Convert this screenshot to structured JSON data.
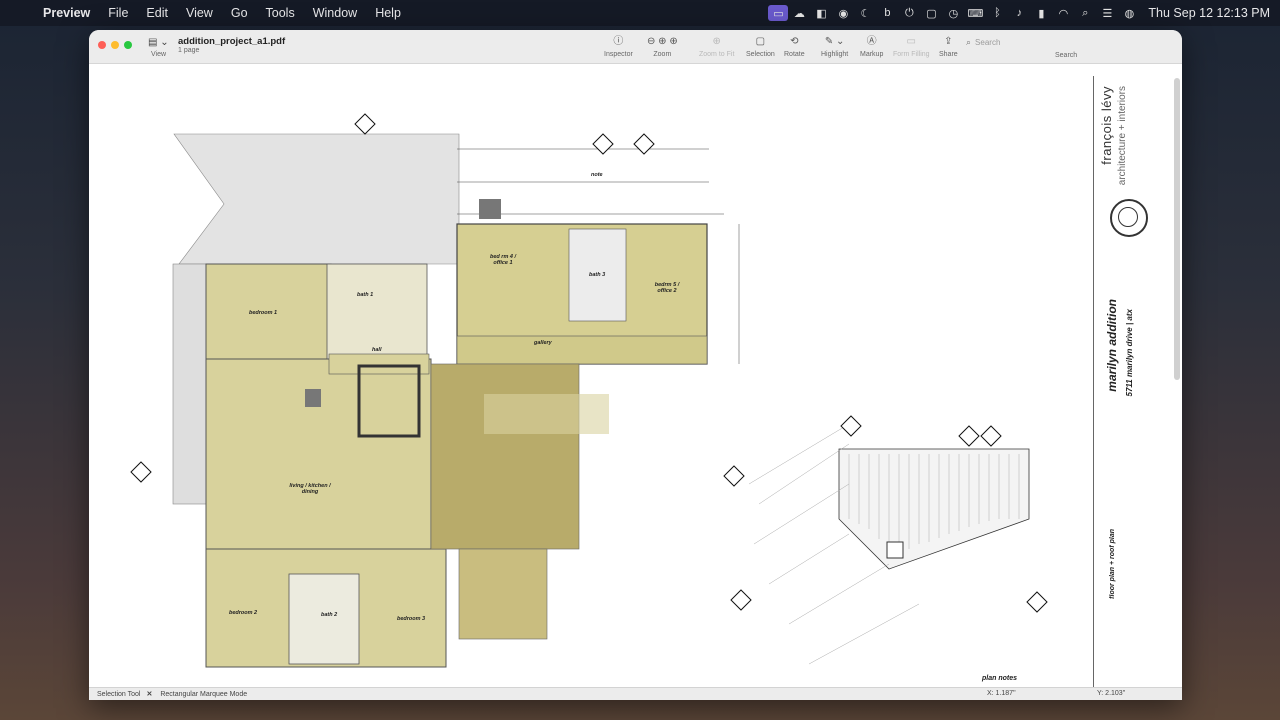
{
  "menubar": {
    "app": "Preview",
    "items": [
      "File",
      "Edit",
      "View",
      "Go",
      "Tools",
      "Window",
      "Help"
    ],
    "clock": "Thu Sep 12  12:13 PM"
  },
  "window": {
    "title": "addition_project_a1.pdf",
    "subtitle": "1 page",
    "view_label": "View",
    "tools": {
      "inspector": "Inspector",
      "zoom": "Zoom",
      "zoom_to_fit": "Zoom to Fit",
      "selection": "Selection",
      "rotate": "Rotate",
      "highlight": "Highlight",
      "markup": "Markup",
      "form_filling": "Form Filling",
      "share": "Share"
    },
    "search": {
      "placeholder": "Search",
      "label": "Search"
    }
  },
  "status": {
    "mode1": "Selection Tool",
    "mode2": "Rectangular Marquee Mode",
    "x": "X: 1.187\"",
    "y": "Y: 2.103\""
  },
  "drawing": {
    "rooms": {
      "bedroom1": "bedroom 1",
      "bath1": "bath 1",
      "hall": "hall",
      "living": "living / kitchen / dining",
      "bedroom2": "bedroom 2",
      "bath2": "bath 2",
      "bedroom3": "bedroom 3",
      "bedrm4": "bed rm 4 / office 1",
      "bath3": "bath 3",
      "bedrm5": "bedrm 5 / office 2",
      "gallery": "gallery"
    },
    "note": "note",
    "plan_notes": "plan notes"
  },
  "title_block": {
    "firm": "françois lévy",
    "firm_sub": "architecture + interiors",
    "project": "marilyn addition",
    "address": "5711 marilyn drive  |  atx",
    "sheet": "floor plan + roof plan"
  },
  "colors": {
    "room_fill": "#d8d29c",
    "addition_fill": "#c8bf86",
    "deck_fill": "#b9aa6e",
    "porch_fill": "#dcdcdc"
  }
}
